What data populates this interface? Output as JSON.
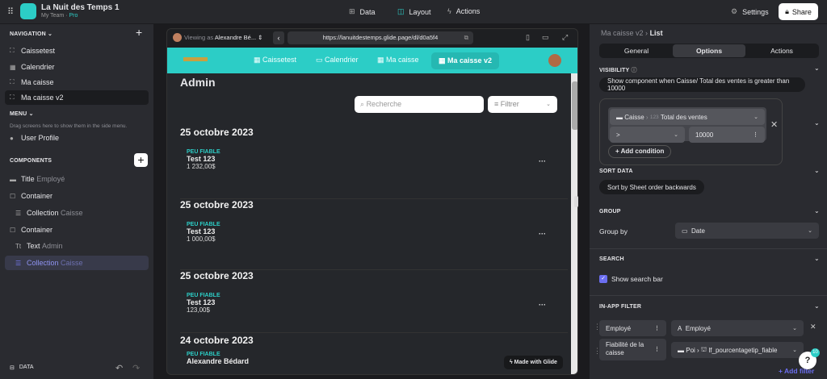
{
  "app": {
    "title": "La Nuit des Temps 1",
    "team": "My Team",
    "plan": "Pro"
  },
  "topnav": {
    "data": "Data",
    "layout": "Layout",
    "actions": "Actions",
    "settings": "Settings",
    "share": "Share"
  },
  "sidebar": {
    "navigation_label": "NAVIGATION",
    "nav_items": [
      {
        "label": "Caissetest"
      },
      {
        "label": "Calendrier"
      },
      {
        "label": "Ma caisse"
      },
      {
        "label": "Ma caisse v2"
      }
    ],
    "menu_label": "MENU",
    "menu_hint": "Drag screens here to show them in the side menu.",
    "user_profile": "User Profile",
    "components_label": "COMPONENTS",
    "components": [
      {
        "type": "Title",
        "sub": "Employé"
      },
      {
        "type": "Container",
        "sub": ""
      },
      {
        "type": "Collection",
        "sub": "Caisse"
      },
      {
        "type": "Container",
        "sub": ""
      },
      {
        "type": "Text",
        "sub": "Admin"
      },
      {
        "type": "Collection",
        "sub": "Caisse"
      }
    ],
    "data_label": "DATA"
  },
  "preview": {
    "viewing_as": "Viewing as",
    "viewer": "Alexandre Bé...",
    "url": "https://lanuitdestemps.glide.page/dl/d0a5f4",
    "tabs": [
      "Caissetest",
      "Calendrier",
      "Ma caisse",
      "Ma caisse v2"
    ],
    "page_title": "Admin",
    "search_placeholder": "Recherche",
    "filter_label": "Filtrer",
    "groups": [
      {
        "date": "25 octobre 2023",
        "tag": "PEU FIABLE",
        "title": "Test 123",
        "amount": "1 232,00$"
      },
      {
        "date": "25 octobre 2023",
        "tag": "PEU FIABLE",
        "title": "Test 123",
        "amount": "1 000,00$"
      },
      {
        "date": "25 octobre 2023",
        "tag": "PEU FIABLE",
        "title": "Test 123",
        "amount": "123,00$"
      },
      {
        "date": "24 octobre 2023",
        "tag": "PEU FIABLE",
        "title": "Alexandre Bédard",
        "amount": ""
      }
    ],
    "made_with": "Made with Glide"
  },
  "panel": {
    "breadcrumb_parent": "Ma caisse v2",
    "breadcrumb_current": "List",
    "tabs": [
      "General",
      "Options",
      "Actions"
    ],
    "visibility_label": "VISIBILITY",
    "visibility_summary": "Show component when Caisse/ Total des ventes is greater than 10000",
    "cond_table": "Caisse",
    "cond_type": "123",
    "cond_column": "Total des ventes",
    "cond_operator": ">",
    "cond_value": "10000",
    "add_condition": "Add condition",
    "sort_label": "SORT DATA",
    "sort_value": "Sort by Sheet order backwards",
    "group_label": "GROUP",
    "group_by": "Group by",
    "group_value": "Date",
    "search_label": "SEARCH",
    "show_search": "Show search bar",
    "filter_label": "IN-APP FILTER",
    "filters": [
      {
        "name": "Employé",
        "type": "A",
        "value": "Employé"
      },
      {
        "name": "Fiabilité de la caisse",
        "type": "Poi",
        "value": "lf_pourcentagetip_fiable"
      }
    ],
    "add_filter": "Add filter",
    "help": "?",
    "help_badge": "10"
  },
  "colors": {
    "accent": "#2ccdc6",
    "purple": "#6b6ef0"
  }
}
